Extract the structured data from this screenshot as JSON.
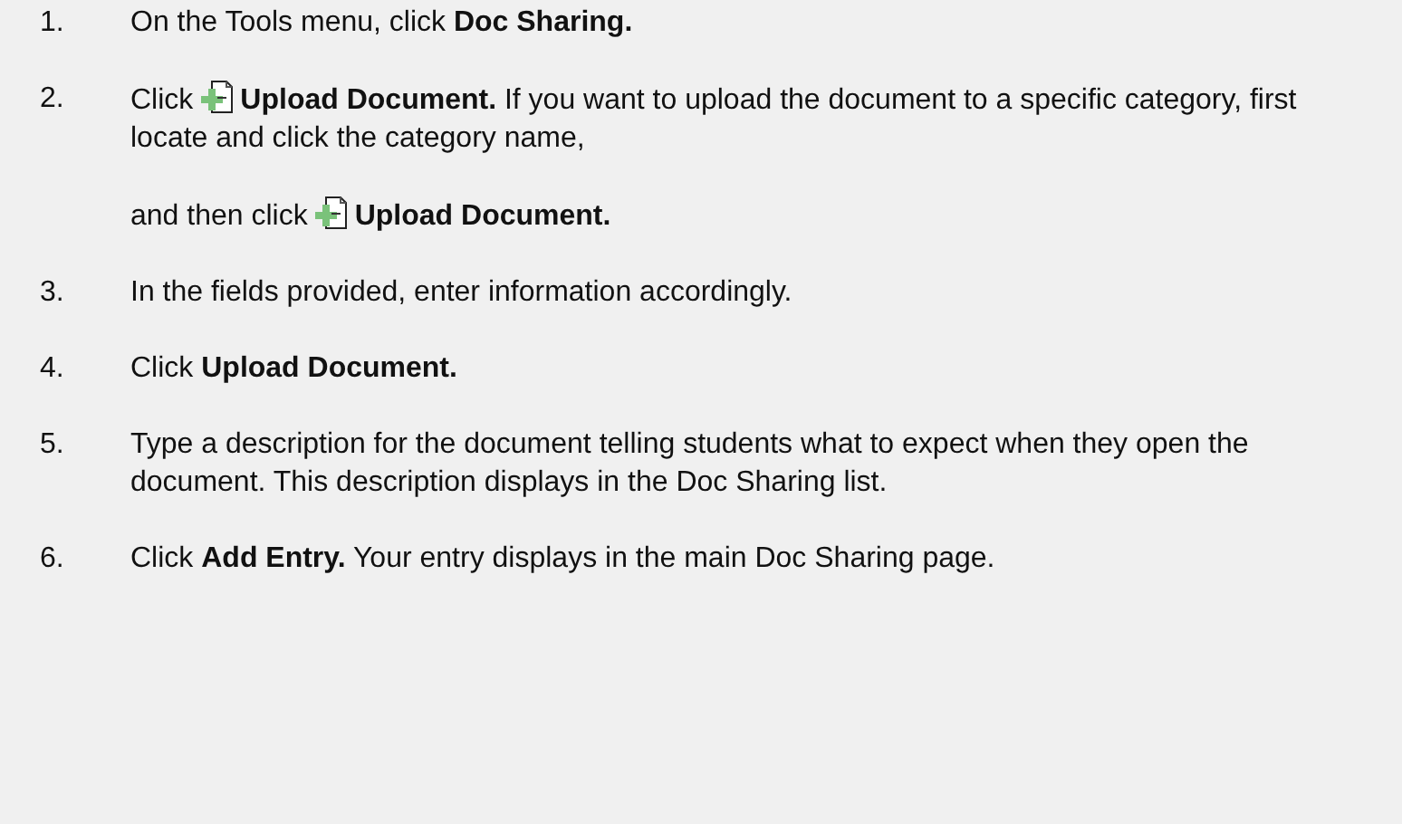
{
  "steps": [
    {
      "number": "1.",
      "paragraphs": [
        [
          {
            "kind": "text",
            "text": "On the Tools menu, click **Doc Sharing.**"
          }
        ]
      ]
    },
    {
      "number": "2.",
      "paragraphs": [
        [
          {
            "kind": "text",
            "text": "Click"
          },
          {
            "kind": "icon"
          },
          {
            "kind": "text",
            "text": "**Upload Document.** If you want to upload the document to a specific category, first locate and click the category name,"
          }
        ],
        [
          {
            "kind": "text",
            "text": "and then click"
          },
          {
            "kind": "icon"
          },
          {
            "kind": "text",
            "text": "**Upload Document.**"
          }
        ]
      ]
    },
    {
      "number": "3.",
      "paragraphs": [
        [
          {
            "kind": "text",
            "text": "In the fields provided, enter information accordingly."
          }
        ]
      ]
    },
    {
      "number": "4.",
      "paragraphs": [
        [
          {
            "kind": "text",
            "text": "Click **Upload Document.**"
          }
        ]
      ]
    },
    {
      "number": "5.",
      "paragraphs": [
        [
          {
            "kind": "text",
            "text": "Type a description for the document telling students what to expect when they open the document. This description displays in the Doc Sharing list."
          }
        ]
      ]
    },
    {
      "number": "6.",
      "paragraphs": [
        [
          {
            "kind": "text",
            "text": "Click **Add Entry.** Your entry displays in the main Doc Sharing page."
          }
        ]
      ]
    }
  ]
}
